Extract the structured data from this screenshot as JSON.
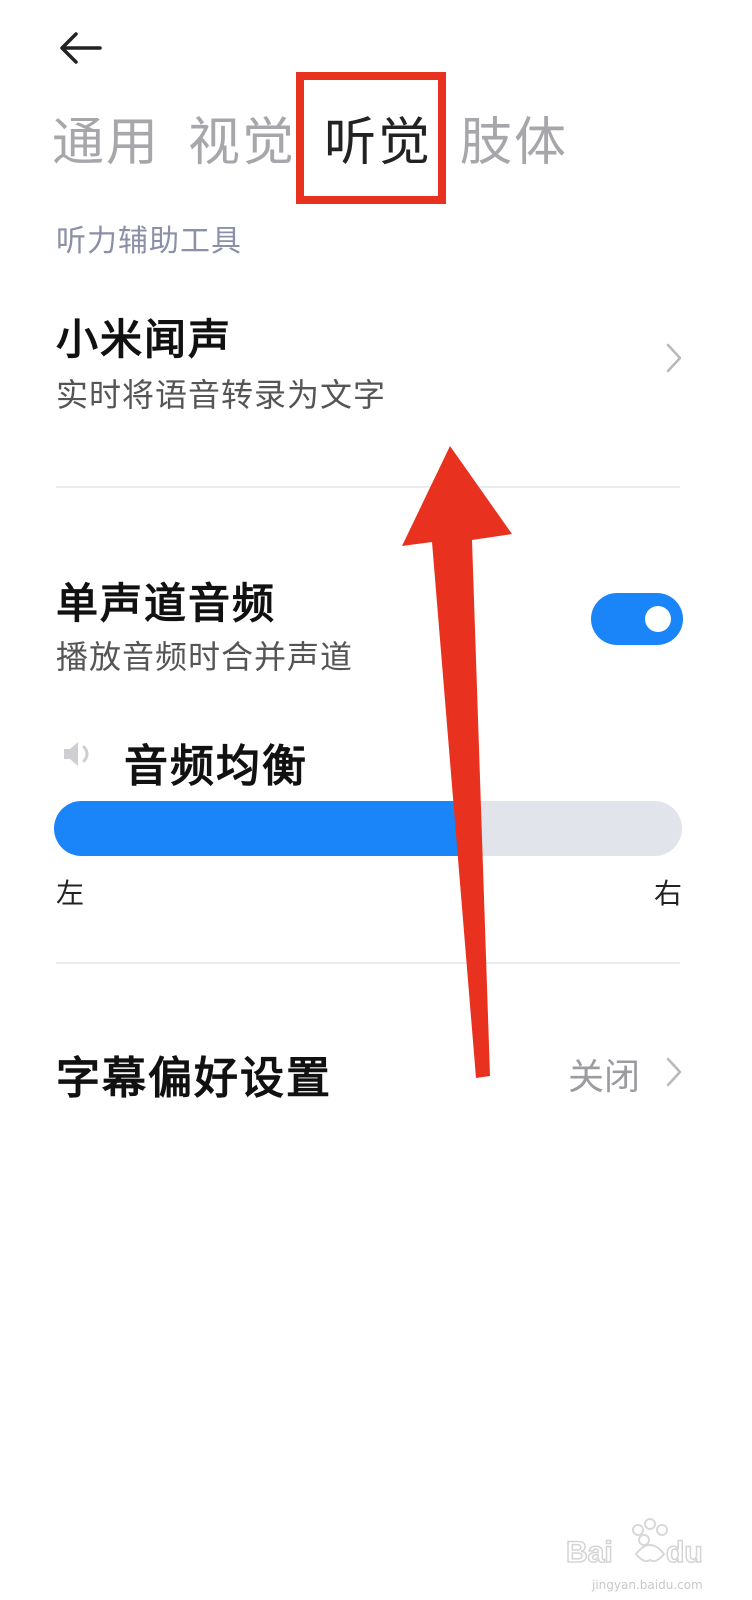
{
  "tabs": [
    {
      "label": "通用",
      "active": false
    },
    {
      "label": "视觉",
      "active": false
    },
    {
      "label": "听觉",
      "active": true
    },
    {
      "label": "肢体",
      "active": false
    }
  ],
  "section": {
    "title": "听力辅助工具"
  },
  "items": {
    "mi_hearing": {
      "title": "小米闻声",
      "subtitle": "实时将语音转录为文字"
    },
    "mono_audio": {
      "title": "单声道音频",
      "subtitle": "播放音频时合并声道",
      "toggle_on": true
    },
    "audio_balance": {
      "title": "音频均衡",
      "left_label": "左",
      "right_label": "右",
      "value_fraction": 0.65
    },
    "caption_prefs": {
      "title": "字幕偏好设置",
      "value": "关闭"
    }
  },
  "icons": {
    "back": "arrow-left-icon",
    "chevron": "chevron-right-icon",
    "speaker": "speaker-icon"
  },
  "colors": {
    "accent": "#1a85f8",
    "annotation": "#e8321f",
    "track": "#e2e4ec"
  },
  "watermark": {
    "text": "Baidu经验",
    "subtext": "jingyan.baidu.com"
  }
}
